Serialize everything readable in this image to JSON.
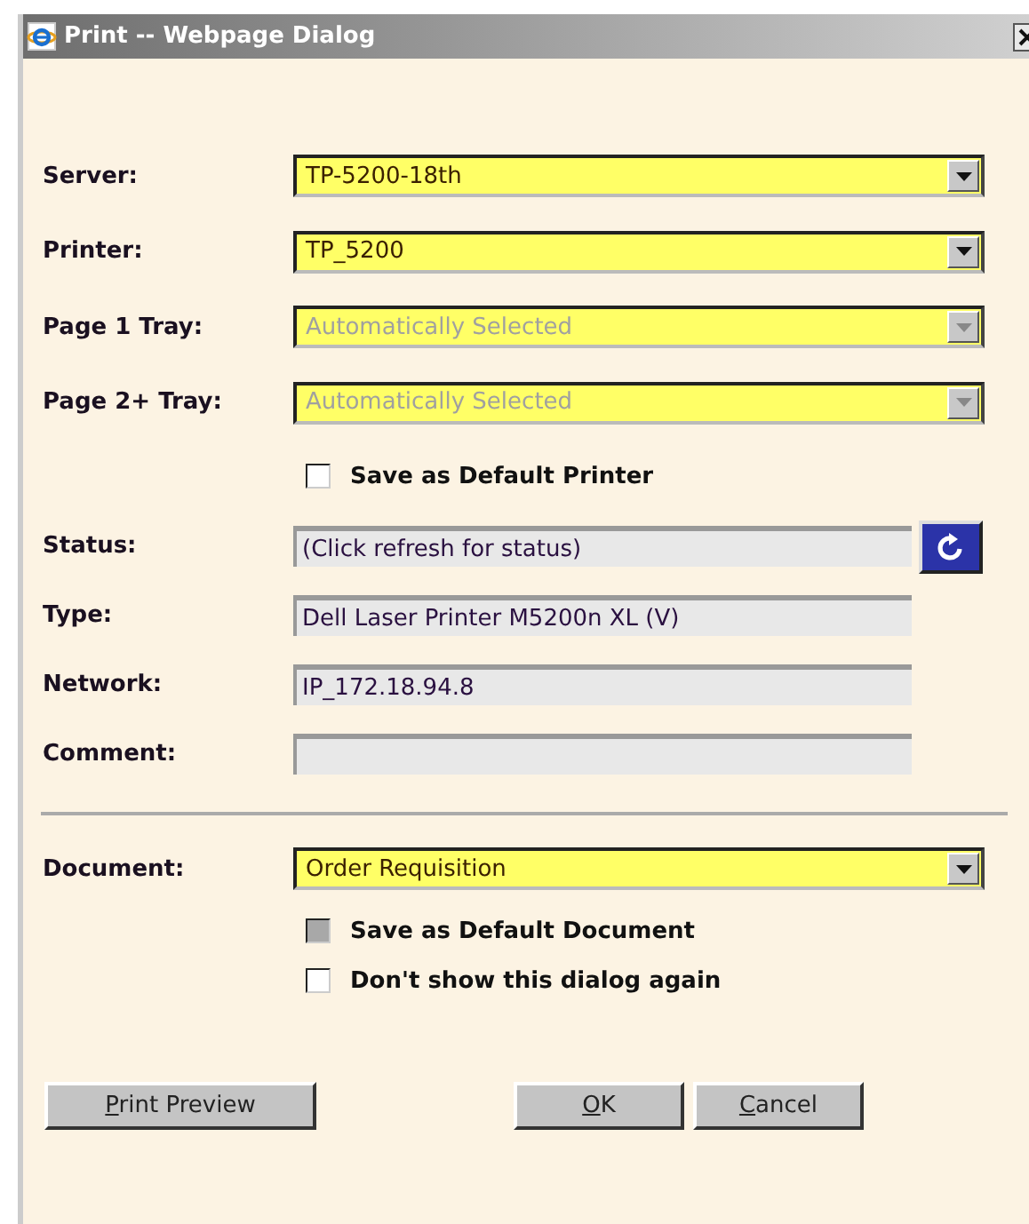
{
  "window": {
    "title": "Print -- Webpage Dialog"
  },
  "printer_fields": [
    {
      "kind": "select",
      "label": "Server:",
      "value": "TP-5200-18th",
      "disabled": false
    },
    {
      "kind": "select",
      "label": "Printer:",
      "value": "TP_5200",
      "disabled": false
    },
    {
      "kind": "select",
      "label": "Page 1 Tray:",
      "value": "Automatically Selected",
      "disabled": true
    },
    {
      "kind": "select",
      "label": "Page 2+ Tray:",
      "value": "Automatically Selected",
      "disabled": true
    },
    {
      "kind": "checkbox",
      "label": "Save as Default Printer",
      "checked": false,
      "disabled": false
    },
    {
      "kind": "text",
      "label": "Status:",
      "value": "(Click refresh for status)",
      "refresh": true
    },
    {
      "kind": "text",
      "label": "Type:",
      "value": "Dell Laser Printer M5200n XL (V)",
      "refresh": false
    },
    {
      "kind": "text",
      "label": "Network:",
      "value": "IP_172.18.94.8",
      "refresh": false
    },
    {
      "kind": "text",
      "label": "Comment:",
      "refresh": false
    }
  ],
  "document_fields": [
    {
      "kind": "select",
      "label": "Document:",
      "value": "Order Requisition",
      "disabled": false
    },
    {
      "kind": "checkbox",
      "label": "Save as Default Document",
      "checked": false,
      "disabled": true
    },
    {
      "kind": "checkbox",
      "label": "Don't show this dialog again",
      "checked": false,
      "disabled": false
    }
  ],
  "buttons": [
    {
      "label": "Print Preview"
    },
    {
      "label": "OK"
    },
    {
      "label": "Cancel"
    }
  ]
}
